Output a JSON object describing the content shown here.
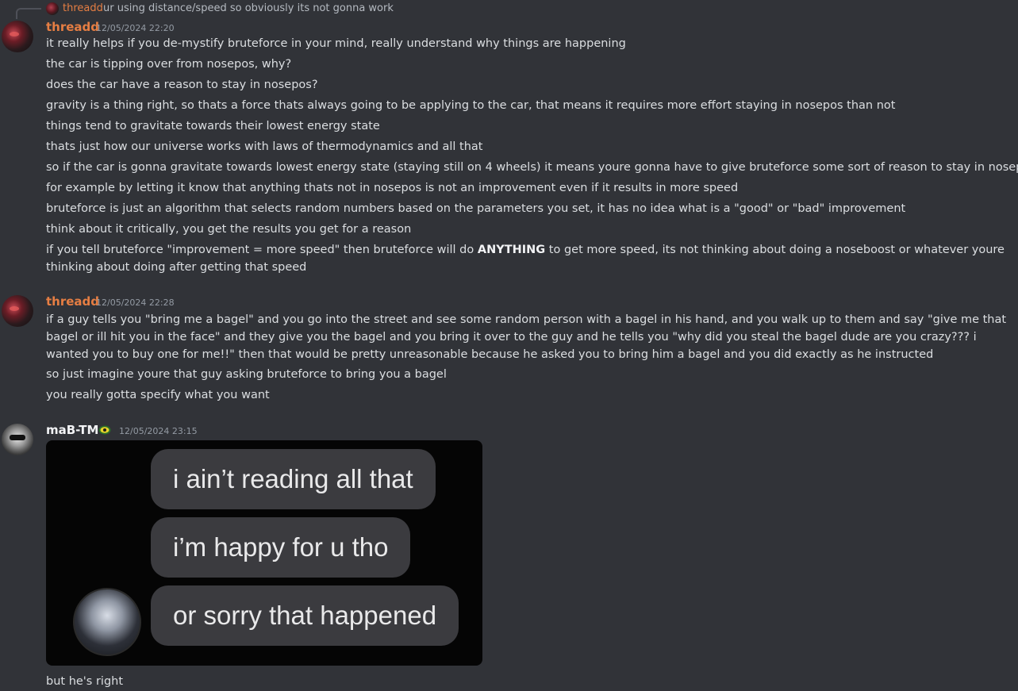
{
  "reply": {
    "author": "threadd",
    "text": "ur using distance/speed so obviously its not gonna work"
  },
  "messages": [
    {
      "author": "threadd",
      "timestamp": "12/05/2024 22:20",
      "lines": [
        "it really helps if you de-mystify bruteforce in your mind, really understand why things are happening",
        "the car is tipping over from nosepos, why?",
        "does the car have a reason to stay in nosepos?",
        "gravity is a thing right, so thats a force thats always going to be applying to the car, that means it requires more effort staying in nosepos than not",
        "things tend to gravitate towards their lowest energy state",
        "thats just how our universe works with laws of thermodynamics and all that",
        "so if the car is gonna gravitate towards lowest energy state (staying still on 4 wheels) it means youre gonna have to give bruteforce some sort of reason to stay in nosepos",
        "for example by letting it know that anything thats not in nosepos is not an improvement even if it results in more speed",
        "bruteforce is just an algorithm that selects random numbers based on the parameters you set, it has no idea what is a \"good\" or \"bad\" improvement",
        "think about it critically, you get the results you get for a reason"
      ],
      "last_line": {
        "before": "if you tell bruteforce \"improvement = more speed\" then bruteforce will do ",
        "bold": "ANYTHING",
        "after": " to get more speed, its not thinking about doing a noseboost or whatever youre thinking about doing after getting that speed"
      }
    },
    {
      "author": "threadd",
      "timestamp": "12/05/2024 22:28",
      "paragraph": "if a guy tells you \"bring me a bagel\" and you go into the street and see some random person with a bagel in his hand, and you walk up to them and say \"give me that bagel or ill hit you in the face\" and they give you the bagel and you bring it over to the guy and he tells you \"why did you steal the bagel dude are you crazy??? i wanted you to buy one for me!!\" then that would be pretty unreasonable because he asked you to bring him a bagel and you did exactly as he instructed",
      "lines": [
        "so just imagine youre that guy asking bruteforce to bring you a bagel",
        "you really gotta specify what you want"
      ]
    },
    {
      "author": "maB-TM",
      "timestamp": "12/05/2024 23:15",
      "badge_icon": "gear-badge-icon",
      "image_bubbles": [
        "i ain’t reading all that",
        "i’m happy for u tho",
        "or sorry that happened"
      ],
      "caption": "but he's right"
    }
  ],
  "colors": {
    "background": "#313338",
    "username_orange": "#e67e43",
    "text": "#dbdee1",
    "muted": "#949ba4"
  }
}
